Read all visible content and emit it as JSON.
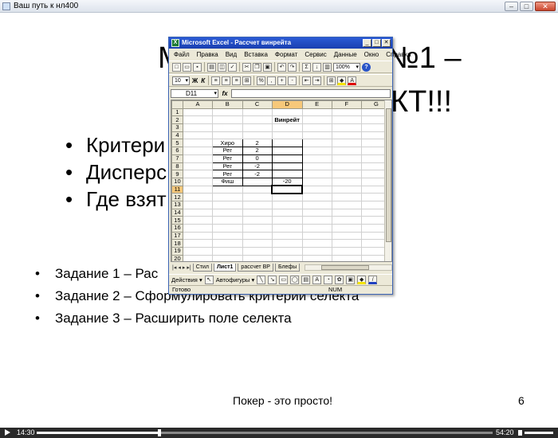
{
  "player": {
    "title": "Ваш путь к нл400",
    "time_elapsed": "14:30",
    "time_total": "54:20",
    "progress": 0.27
  },
  "slide": {
    "title_left": "М",
    "title_right": "№1 –",
    "title_line2": "КТ!!!",
    "bullets": [
      "Критери",
      "Дисперс",
      "Где взят"
    ],
    "tasks": [
      "Задание 1 – Рас",
      "Задание 2 – Сформулировать критерии селекта",
      "Задание 3 – Расширить поле селекта"
    ],
    "footer": "Покер - это просто!",
    "page_number": "6"
  },
  "excel": {
    "title": "Microsoft Excel - Рассчет винрейта",
    "menu": [
      "Файл",
      "Правка",
      "Вид",
      "Вставка",
      "Формат",
      "Сервис",
      "Данные",
      "Окно",
      "Справка"
    ],
    "zoom": "100%",
    "font_size": "10",
    "name_box": "D11",
    "columns": [
      "A",
      "B",
      "C",
      "D",
      "E",
      "F",
      "G"
    ],
    "header_title": "Винрейт",
    "rows": [
      {
        "n": "1",
        "b": "",
        "c": "",
        "d": ""
      },
      {
        "n": "2",
        "b": "",
        "c": "",
        "d": "Винрейт"
      },
      {
        "n": "3",
        "b": "",
        "c": "",
        "d": ""
      },
      {
        "n": "4",
        "b": "",
        "c": "",
        "d": ""
      },
      {
        "n": "5",
        "b": "Хиро",
        "c": "2",
        "d": ""
      },
      {
        "n": "6",
        "b": "Рег",
        "c": "2",
        "d": ""
      },
      {
        "n": "7",
        "b": "Рег",
        "c": "0",
        "d": ""
      },
      {
        "n": "8",
        "b": "Рег",
        "c": "-2",
        "d": ""
      },
      {
        "n": "9",
        "b": "Рег",
        "c": "-2",
        "d": ""
      },
      {
        "n": "10",
        "b": "Фиш",
        "c": "",
        "d": "-20"
      },
      {
        "n": "11",
        "b": "",
        "c": "",
        "d": ""
      },
      {
        "n": "12",
        "b": "",
        "c": "",
        "d": ""
      },
      {
        "n": "13",
        "b": "",
        "c": "",
        "d": ""
      },
      {
        "n": "14",
        "b": "",
        "c": "",
        "d": ""
      },
      {
        "n": "15",
        "b": "",
        "c": "",
        "d": ""
      },
      {
        "n": "16",
        "b": "",
        "c": "",
        "d": ""
      },
      {
        "n": "17",
        "b": "",
        "c": "",
        "d": ""
      },
      {
        "n": "18",
        "b": "",
        "c": "",
        "d": ""
      },
      {
        "n": "19",
        "b": "",
        "c": "",
        "d": ""
      },
      {
        "n": "20",
        "b": "",
        "c": "",
        "d": ""
      }
    ],
    "sheet_tabs": [
      "Стил",
      "Лист1",
      "рассчет ВР",
      "Блефы"
    ],
    "active_tab": "Лист1",
    "draw_actions": "Действия ▾",
    "autoshapes": "Автофигуры ▾",
    "status_ready": "Готово",
    "status_num": "NUM"
  }
}
